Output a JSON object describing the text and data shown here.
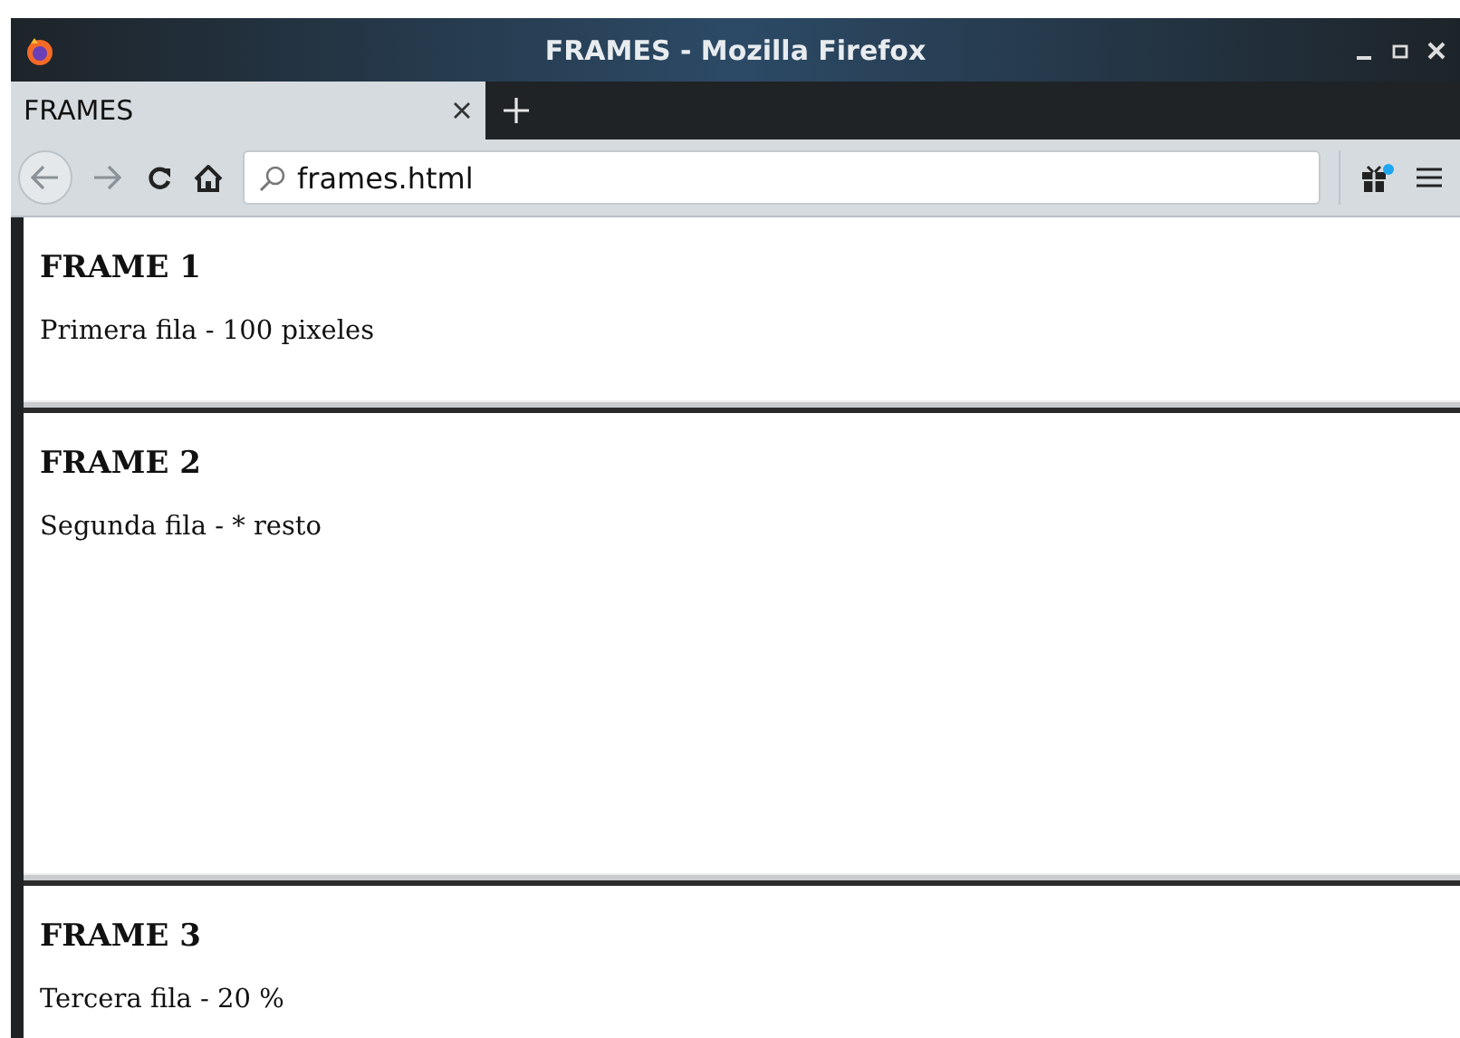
{
  "window": {
    "title": "FRAMES - Mozilla Firefox"
  },
  "tabs": [
    {
      "label": "FRAMES",
      "selected": true
    }
  ],
  "address_bar": {
    "value": "frames.html"
  },
  "frames": [
    {
      "heading": "FRAME 1",
      "text": "Primera fila - 100 pixeles"
    },
    {
      "heading": "FRAME 2",
      "text": "Segunda fila - * resto"
    },
    {
      "heading": "FRAME 3",
      "text": "Tercera fila - 20 %"
    }
  ]
}
